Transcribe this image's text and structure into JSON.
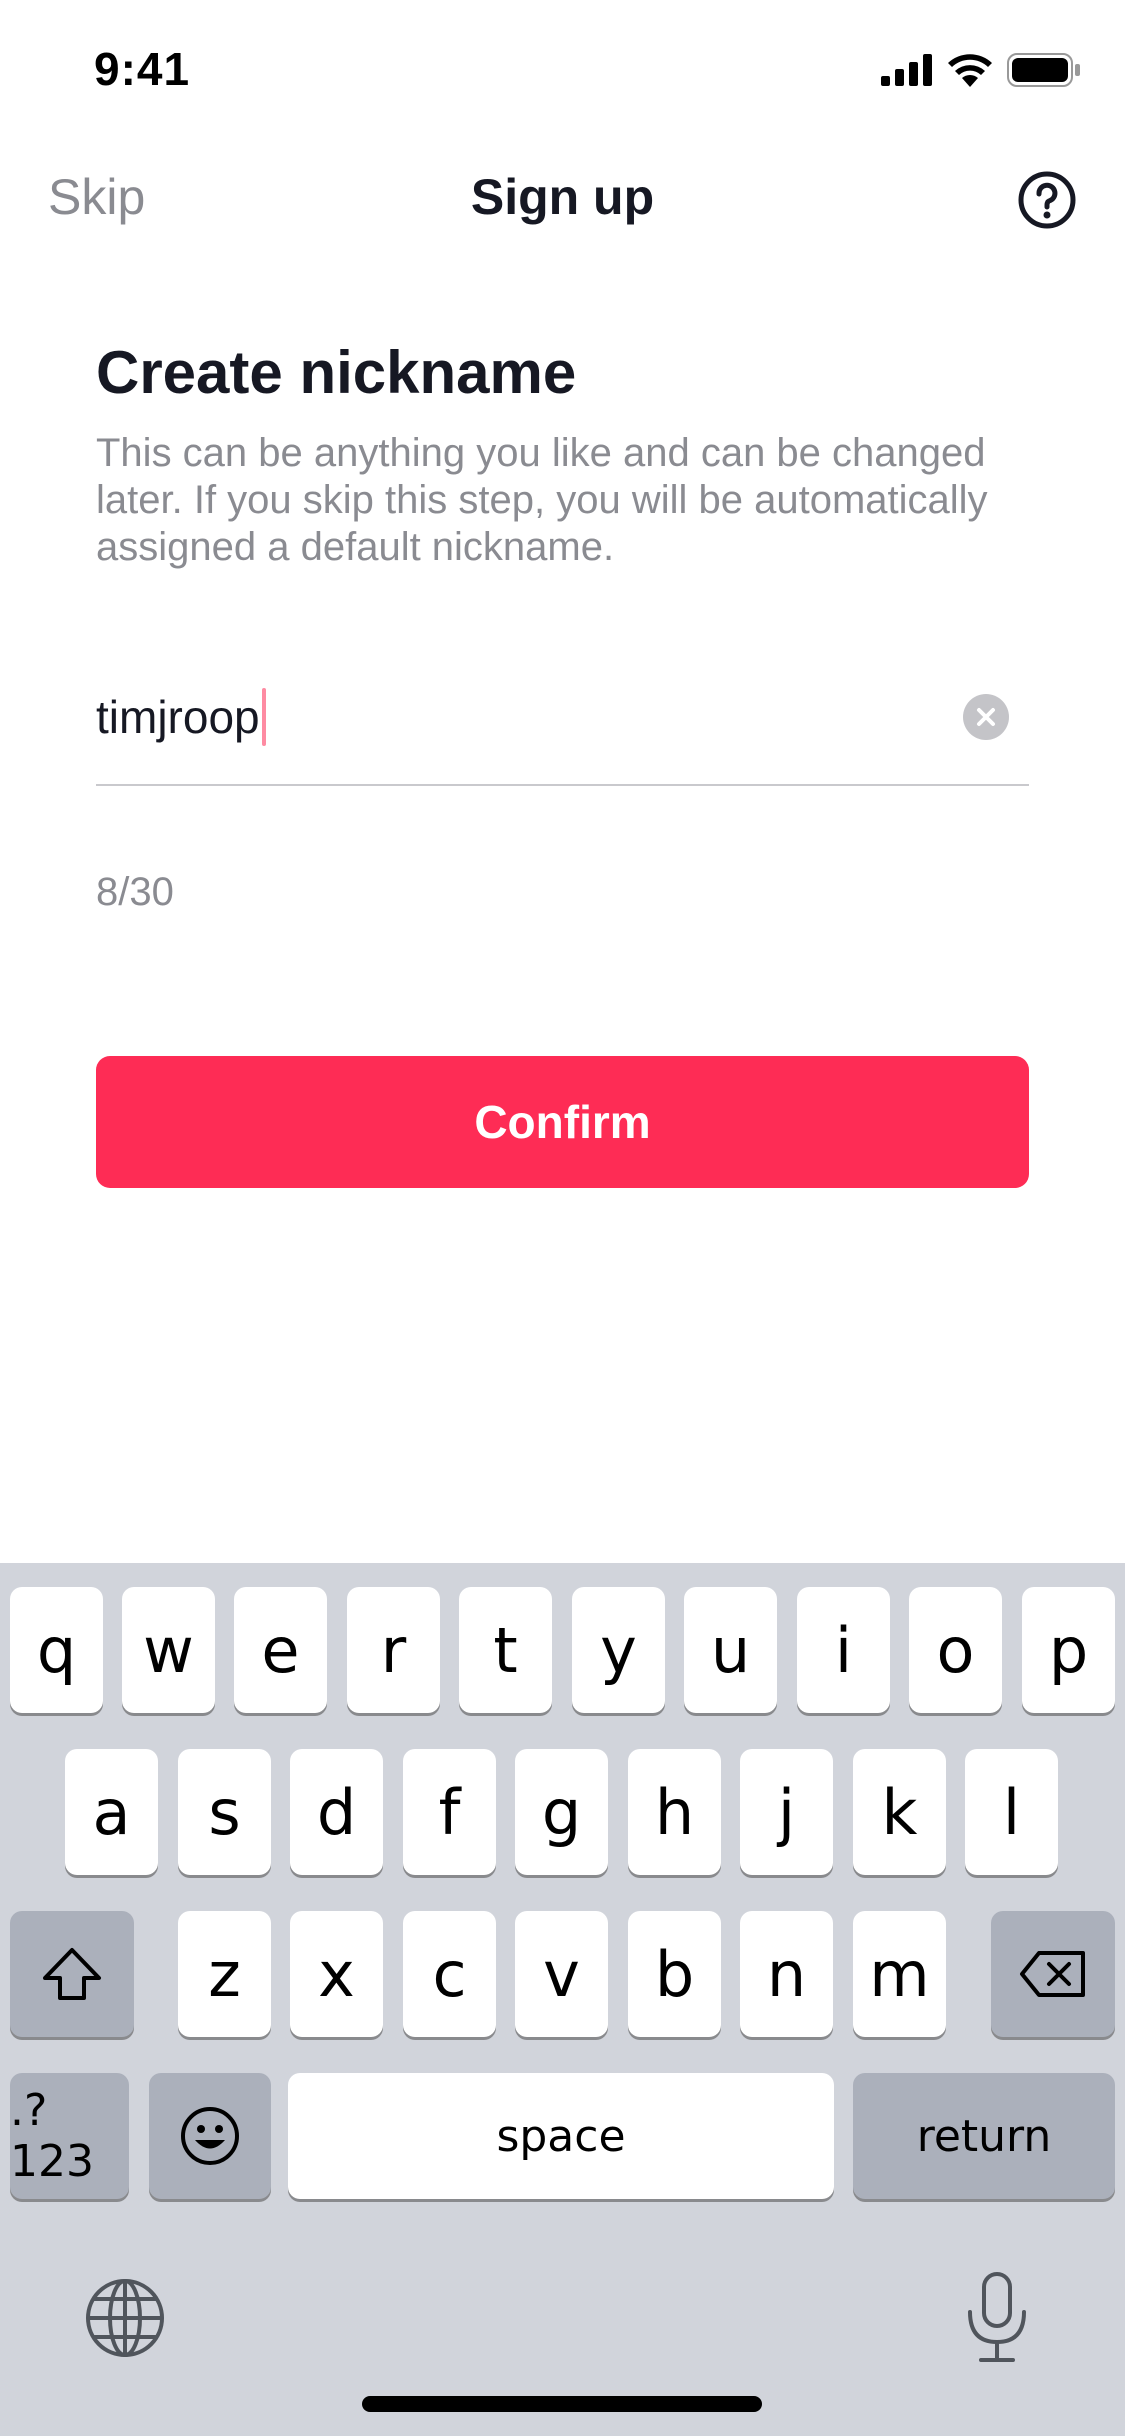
{
  "status_bar": {
    "time": "9:41",
    "icons": [
      "signal-icon",
      "wifi-icon",
      "battery-icon"
    ]
  },
  "nav": {
    "skip_label": "Skip",
    "title": "Sign up",
    "help_icon": "help-circle-icon"
  },
  "form": {
    "heading": "Create nickname",
    "description": "This can be anything you like and can be changed later. If you skip this step, you will be automatically assigned a default nickname.",
    "nickname_value": "timjroop",
    "counter": "8/30",
    "confirm_label": "Confirm"
  },
  "keyboard": {
    "row1": [
      "q",
      "w",
      "e",
      "r",
      "t",
      "y",
      "u",
      "i",
      "o",
      "p"
    ],
    "row2": [
      "a",
      "s",
      "d",
      "f",
      "g",
      "h",
      "j",
      "k",
      "l"
    ],
    "row3": [
      "z",
      "x",
      "c",
      "v",
      "b",
      "n",
      "m"
    ],
    "numbers_label": ".?123",
    "space_label": "space",
    "return_label": "return",
    "icons": [
      "shift-icon",
      "backspace-icon",
      "emoji-icon",
      "globe-icon",
      "microphone-icon"
    ]
  },
  "colors": {
    "accent": "#fe2c55",
    "text_primary": "#161823",
    "text_secondary": "#8a8b91",
    "keyboard_bg": "#d1d4db"
  }
}
